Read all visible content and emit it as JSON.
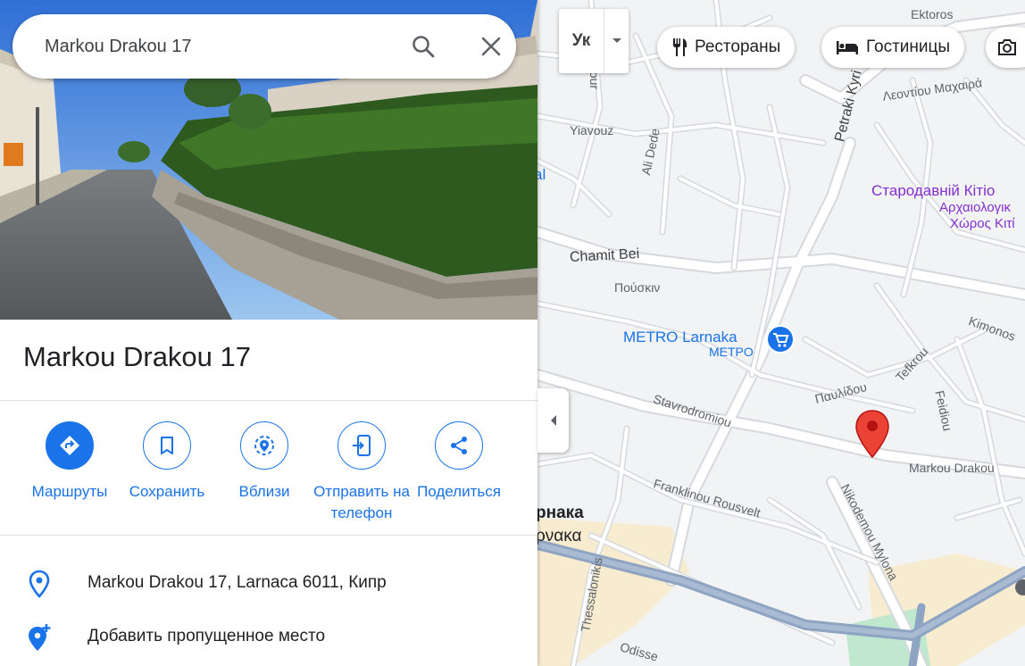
{
  "search": {
    "value": "Markou Drakou 17"
  },
  "place": {
    "title": "Markou Drakou 17"
  },
  "actions": [
    {
      "label": "Маршруты"
    },
    {
      "label": "Сохранить"
    },
    {
      "label": "Вблизи"
    },
    {
      "label": "Отправить на телефон"
    },
    {
      "label": "Поделиться"
    }
  ],
  "info": {
    "address": "Markou Drakou 17, Larnaca 6011, Кипр",
    "add_place": "Добавить пропущенное место"
  },
  "map_controls": {
    "layers_label": "Ук",
    "chips": [
      {
        "label": "Рестораны"
      },
      {
        "label": "Гостиницы"
      }
    ]
  },
  "map_labels": {
    "ektoros": "Ektoros",
    "iour": "Iour",
    "yiavouz": "Yiavouz",
    "ali_dede": "Ali Dede",
    "petraki": "Petraki Kyri",
    "leontiou": "Λεοντίου Μαχαιρά",
    "al": "al",
    "starodavnii": "Стародавній Кітіо",
    "archaiologikos": "Αρχαιολογικ",
    "choros": "Χώρος Κιτί",
    "chamit_bei": "Chamit Bei",
    "pouskin": "Πούσκιν",
    "metro": "METRO Larnaka",
    "metro_gr": "ΜΕΤΡΟ",
    "kimonos": "Kimonos",
    "pavlidou": "Παυλίδου",
    "tefkrou": "Tefkrou",
    "feidiou": "Feidiou",
    "stavrodromiou": "Stavrodromiou",
    "markou_drakou": "Markou Drakou",
    "franklinou": "Franklinou Rousvelt",
    "nikodemou": "Nikodemou Mylona",
    "lanaka_ru": "рнака",
    "lanaka_gr": "ρνακα",
    "thessalonikis": "Thessalonikis",
    "odisse": "Odisse"
  },
  "colors": {
    "accent": "#1a73e8",
    "pin": "#ea4335",
    "map_bg": "#f1f3f4",
    "road": "#ffffff",
    "highway": "#8ea4c2"
  }
}
